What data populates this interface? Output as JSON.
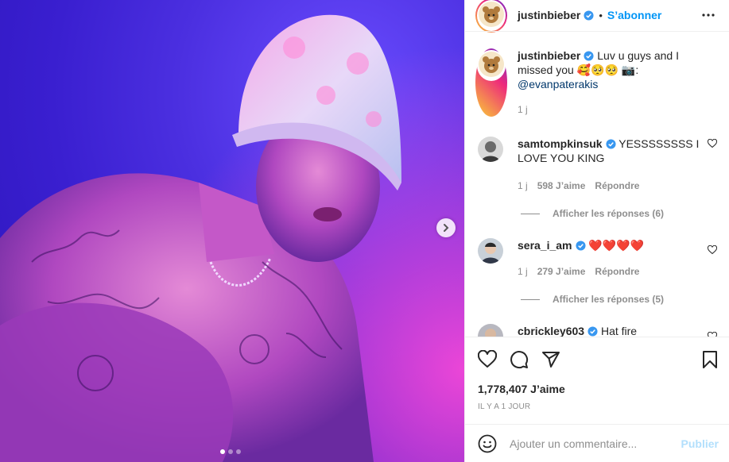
{
  "post": {
    "username": "justinbieber",
    "follow_label": "S’abonner",
    "separator": "•",
    "caption_text": "Luv u guys and I missed you 🥰🥺🥺 📷:",
    "caption_mention": "@evanpaterakis",
    "caption_time": "1 j"
  },
  "comments": [
    {
      "username": "samtompkinsuk",
      "text": "YESSSSSSSS I LOVE YOU KING",
      "time": "1 j",
      "likes": "598 J’aime",
      "reply_label": "Répondre",
      "view_replies": "Afficher les réponses (6)"
    },
    {
      "username": "sera_i_am",
      "text": "❤️❤️❤️❤️",
      "time": "1 j",
      "likes": "279 J’aime",
      "reply_label": "Répondre",
      "view_replies": "Afficher les réponses (5)"
    },
    {
      "username": "cbrickley603",
      "text": "Hat fire"
    }
  ],
  "actions": {
    "likes_count": "1,778,407 J’aime",
    "time_ago": "IL Y A 1 JOUR"
  },
  "comment_box": {
    "placeholder": "Ajouter un commentaire...",
    "publish_label": "Publier"
  },
  "colors": {
    "accent": "#0095f6",
    "publish_disabled": "#b2dffc",
    "verified": "#3897f0",
    "heart_red": "#ed4956",
    "photo_background": "#3a1fd0"
  },
  "icons": [
    "verified-badge-icon",
    "more-options-icon",
    "heart-outline-icon",
    "comment-icon",
    "share-icon",
    "bookmark-icon",
    "emoji-icon",
    "next-arrow-icon"
  ]
}
